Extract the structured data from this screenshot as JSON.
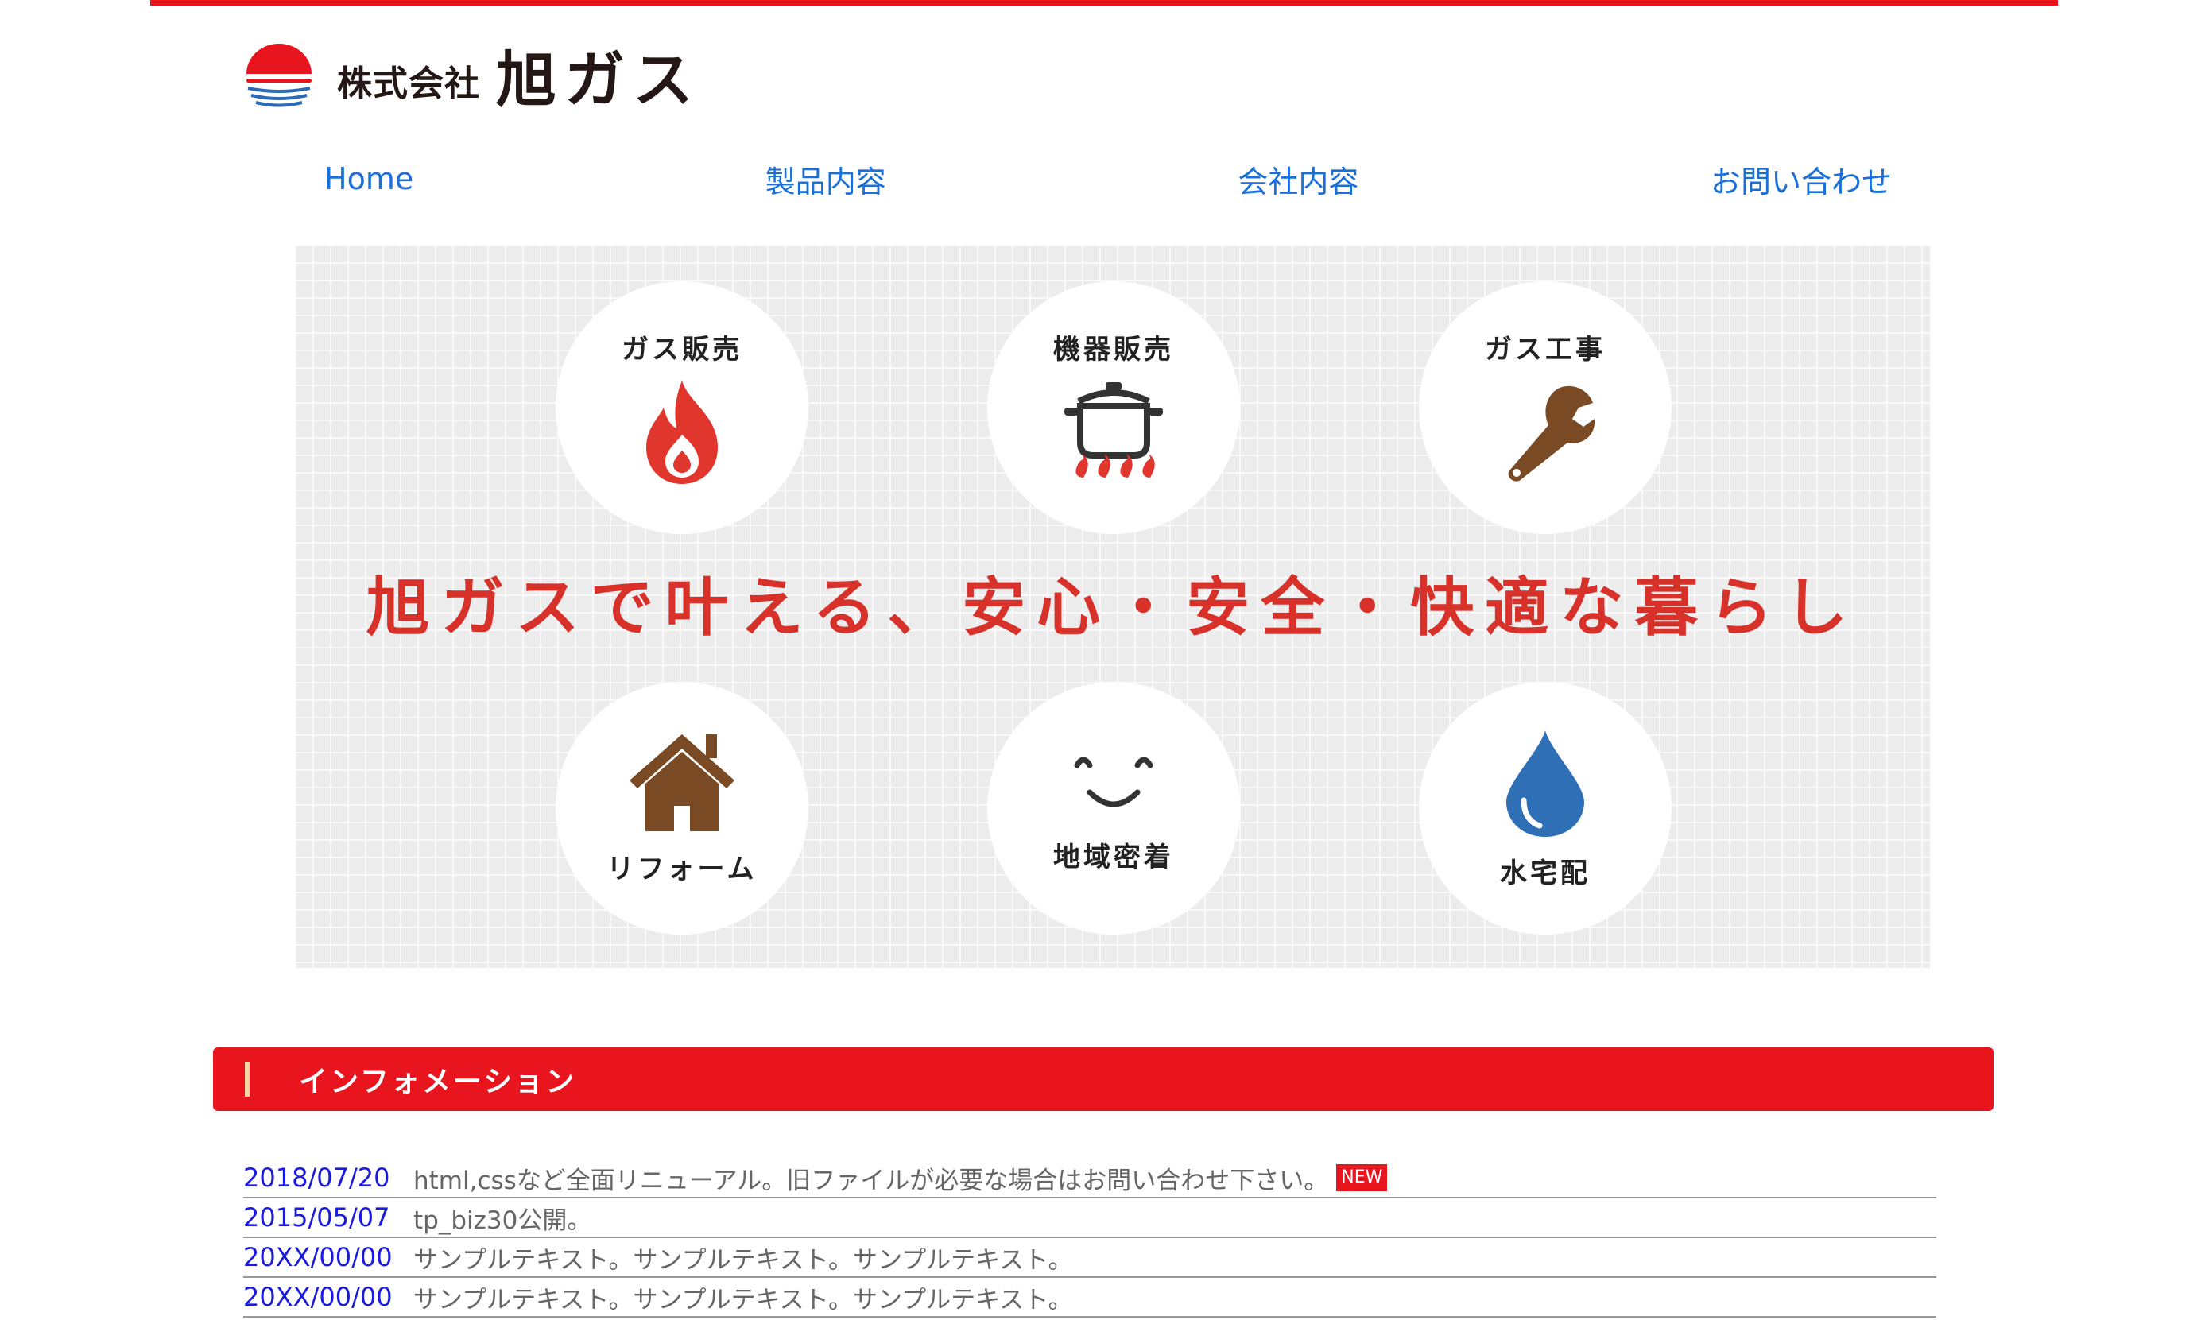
{
  "brand": {
    "company": "株式会社",
    "name": "旭ガス",
    "accent_color": "#e8151e"
  },
  "nav": {
    "items": [
      {
        "label": "Home"
      },
      {
        "label": "製品内容"
      },
      {
        "label": "会社内容"
      },
      {
        "label": "お問い合わせ"
      }
    ]
  },
  "hero": {
    "services": [
      {
        "label": "ガス販売",
        "icon": "flame-icon"
      },
      {
        "label": "機器販売",
        "icon": "pot-icon"
      },
      {
        "label": "ガス工事",
        "icon": "wrench-icon"
      },
      {
        "label": "リフォーム",
        "icon": "house-icon"
      },
      {
        "label": "地域密着",
        "icon": "smile-icon"
      },
      {
        "label": "水宅配",
        "icon": "water-drop-icon"
      }
    ],
    "catchphrase": "旭ガスで叶える、安心・安全・快適な暮らし"
  },
  "info": {
    "title": "インフォメーション",
    "news": [
      {
        "date": "2018/07/20",
        "text": "html,cssなど全面リニューアル。旧ファイルが必要な場合はお問い合わせ下さい。",
        "badge": "NEW"
      },
      {
        "date": "2015/05/07",
        "text": "tp_biz30公開。",
        "badge": ""
      },
      {
        "date": "20XX/00/00",
        "text": "サンプルテキスト。サンプルテキスト。サンプルテキスト。",
        "badge": ""
      },
      {
        "date": "20XX/00/00",
        "text": "サンプルテキスト。サンプルテキスト。サンプルテキスト。",
        "badge": ""
      }
    ]
  }
}
